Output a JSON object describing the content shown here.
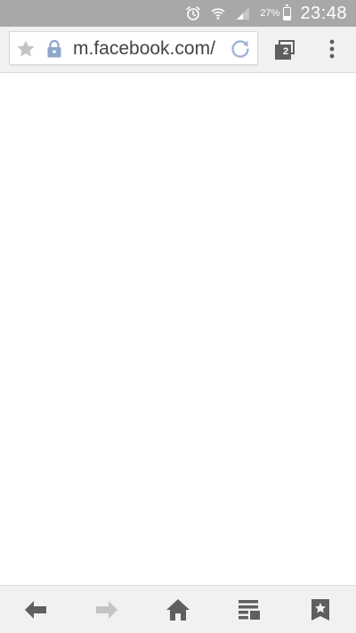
{
  "status_bar": {
    "battery_percent": "27%",
    "time": "23:48",
    "battery_level": 0.27,
    "icons": [
      "alarm-icon",
      "wifi-icon",
      "signal-icon",
      "battery-icon"
    ]
  },
  "toolbar": {
    "url": "m.facebook.com/",
    "tab_count": "2",
    "icons": [
      "bookmark-star-icon",
      "lock-icon",
      "reload-icon",
      "tabs-icon",
      "overflow-menu-icon"
    ]
  },
  "bottom_nav": {
    "buttons": [
      "back-arrow-icon",
      "forward-arrow-icon",
      "home-icon",
      "reader-icon",
      "bookmarks-icon"
    ]
  },
  "colors": {
    "status_bar_bg": "#a8a8a8",
    "toolbar_bg": "#f1f1f1",
    "icon_gray": "#5f5f5f",
    "icon_disabled": "#c4c4c4",
    "lock_blue": "#8ea6c9",
    "reload_blue": "#a0b4d6"
  }
}
